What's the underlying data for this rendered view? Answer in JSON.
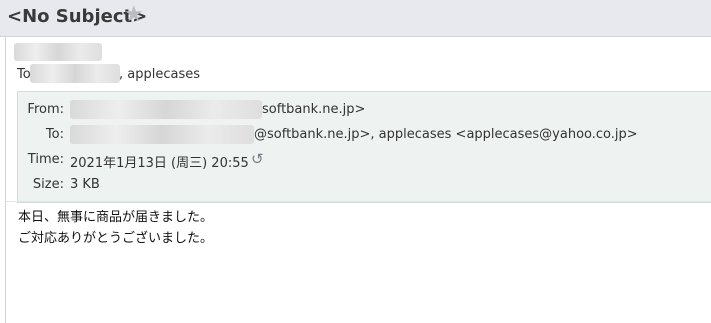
{
  "title_bar": {
    "subject": "<No Subject>",
    "star_icon": "star-icon"
  },
  "recipients_line": {
    "prefix": "To",
    "name": ", applecases"
  },
  "header": {
    "from_label": "From:",
    "from_value": "softbank.ne.jp>",
    "to_label": "To:",
    "to_value": "@softbank.ne.jp>,  applecases <applecases@yahoo.co.jp>",
    "time_label": "Time:",
    "time_value": "2021年1月13日 (周三) 20:55",
    "size_label": "Size:",
    "size_value": "3 KB"
  },
  "body": {
    "line1": "本日、無事に商品が届きました。",
    "line2": "ご対応ありがとうございました。"
  }
}
